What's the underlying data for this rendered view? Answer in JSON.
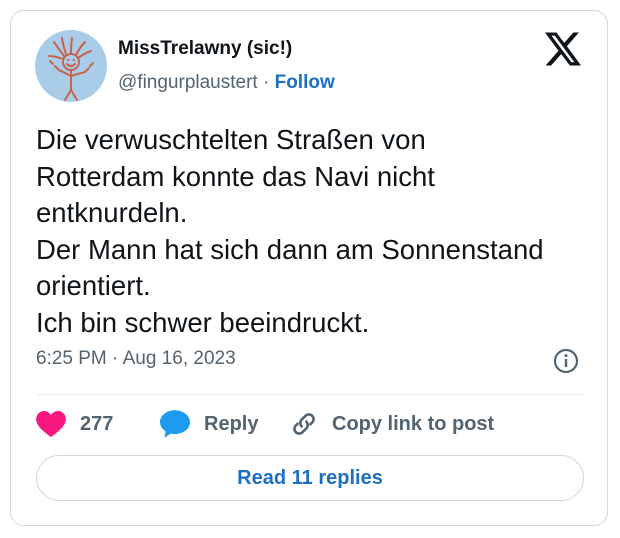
{
  "author": {
    "display_name": "MissTrelawny (sic!)",
    "handle": "@fingurplaustert",
    "separator": "·",
    "follow_label": "Follow",
    "avatar_icon": "stick-figure-avatar-icon"
  },
  "platform_icon": "x-logo-icon",
  "tweet": {
    "lines": [
      "Die verwuschtelten Straßen von",
      "Rotterdam konnte das Navi nicht",
      "entknurdeln.",
      "Der Mann hat sich dann am Sonnenstand",
      "orientiert.",
      "Ich bin schwer beeindruckt."
    ],
    "timestamp": "6:25 PM · Aug 16, 2023",
    "info_icon": "info-icon"
  },
  "actions": {
    "like_count": "277",
    "reply_label": "Reply",
    "copy_label": "Copy link to post"
  },
  "read_replies_label": "Read 11 replies",
  "colors": {
    "heart": "#f91880",
    "reply_bubble": "#1d9bf0",
    "link_blue": "#1d6fc0",
    "avatar_bg": "#a9cde9",
    "muted_text": "#536471"
  }
}
